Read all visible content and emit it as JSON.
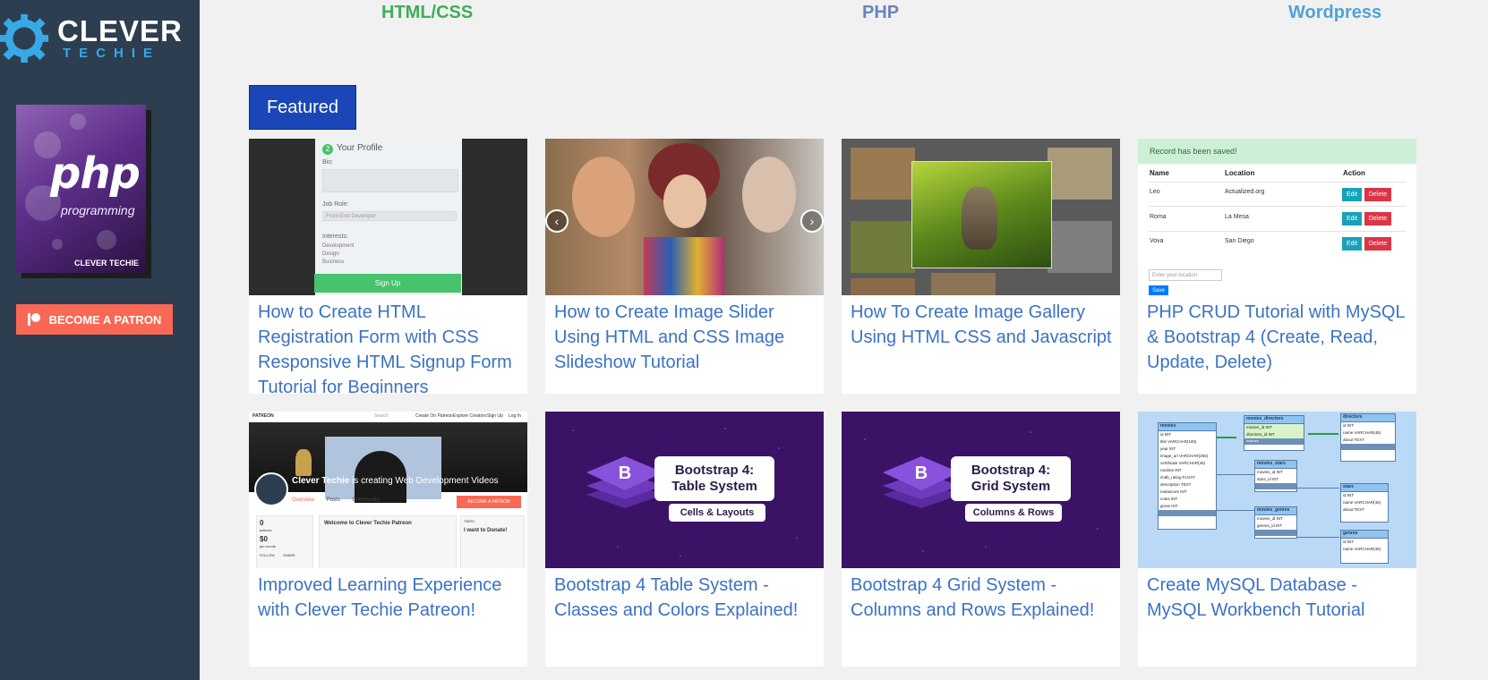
{
  "brand": {
    "name_line1": "CLEVER",
    "name_line2": "TECHIE"
  },
  "nav": {
    "links": [
      {
        "label": "HTML/CSS",
        "color": "#3dae5a"
      },
      {
        "label": "PHP",
        "color": "#6c84bd"
      },
      {
        "label": "Wordpress",
        "color": "#4ea3d8"
      }
    ]
  },
  "sidebar": {
    "book": {
      "title": "php",
      "subtitle": "programming",
      "brand": "CLEVER TECHIE"
    },
    "patron_button": "BECOME A PATRON"
  },
  "featured": {
    "label": "Featured"
  },
  "cards": [
    {
      "title": "How to Create HTML Registration Form with CSS Responsive HTML Signup Form Tutorial for Beginners"
    },
    {
      "title": "How to Create Image Slider Using HTML and CSS Image Slideshow Tutorial"
    },
    {
      "title": "How To Create Image Gallery Using HTML CSS and Javascript"
    },
    {
      "title": "PHP CRUD Tutorial with MySQL & Bootstrap 4 (Create, Read, Update, Delete)"
    },
    {
      "title": "Improved Learning Experience with Clever Techie Patreon!"
    },
    {
      "title": "Bootstrap 4 Table System - Classes and Colors Explained!"
    },
    {
      "title": "Bootstrap 4 Grid System - Columns and Rows Explained!"
    },
    {
      "title": "Create MySQL Database - MySQL Workbench Tutorial"
    }
  ],
  "thumbs": {
    "form": {
      "heading": "Your Profile",
      "step": "2",
      "bio_label": "Bio:",
      "job_label": "Job Role:",
      "job_value": "Front-End Developer",
      "interests_label": "Interests:",
      "interests": [
        "Development",
        "Design",
        "Business"
      ],
      "button": "Sign Up"
    },
    "crud": {
      "alert": "Record has been saved!",
      "headers": [
        "Name",
        "Location",
        "Action"
      ],
      "rows": [
        {
          "name": "Leo",
          "location": "Actualized.org"
        },
        {
          "name": "Roma",
          "location": "La Mesa"
        },
        {
          "name": "Vova",
          "location": "San Diego"
        }
      ],
      "edit": "Edit",
      "delete": "Delete",
      "placeholder": "Enter your location",
      "save": "Save"
    },
    "patreon": {
      "logo": "PATREON",
      "search": "Search",
      "menu": [
        "Create On Patreon",
        "Explore Creators",
        "Sign Up",
        "Log In"
      ],
      "creator": "Clever Techie",
      "tagline": "is creating Web Development Videos",
      "tabs": [
        "Overview",
        "Posts",
        "Community"
      ],
      "button": "BECOME A PATRON",
      "patrons_count": "0",
      "patrons_label": "patrons",
      "amount": "$0",
      "amount_label": "per month",
      "follow": "FOLLOW",
      "share": "SHARE",
      "welcome": "Welcome to Clever Techie Patreon",
      "tiers_label": "TIERS",
      "tier_title": "I want to Donate!"
    },
    "bootstrap_table": {
      "line1": "Bootstrap 4:",
      "line2": "Table System",
      "pill": "Cells & Layouts"
    },
    "bootstrap_grid": {
      "line1": "Bootstrap 4:",
      "line2": "Grid System",
      "pill": "Columns & Rows"
    },
    "workbench": {
      "tables": [
        {
          "name": "movies",
          "cols": [
            "id INT",
            "title VARCHAR(100)",
            "year INT",
            "image_url VARCHAR(255)",
            "certificate VARCHAR(45)",
            "runtime INT",
            "imdb_rating FLOAT",
            "description TEXT",
            "metascore INT",
            "votes INT",
            "gross INT"
          ]
        },
        {
          "name": "movies_directors",
          "cols": [
            "movies_id INT",
            "directors_id INT"
          ]
        },
        {
          "name": "directors",
          "cols": [
            "id INT",
            "name VARCHAR(45)",
            "about TEXT"
          ]
        },
        {
          "name": "movies_stars",
          "cols": [
            "movies_id INT",
            "stars_id INT"
          ]
        },
        {
          "name": "stars",
          "cols": [
            "id INT",
            "name VARCHAR(45)",
            "about TEXT"
          ]
        },
        {
          "name": "movies_genres",
          "cols": [
            "movies_id INT",
            "genres_id INT"
          ]
        },
        {
          "name": "genres",
          "cols": [
            "id INT",
            "name VARCHAR(45)"
          ]
        }
      ],
      "index_label": "Indexes"
    }
  }
}
